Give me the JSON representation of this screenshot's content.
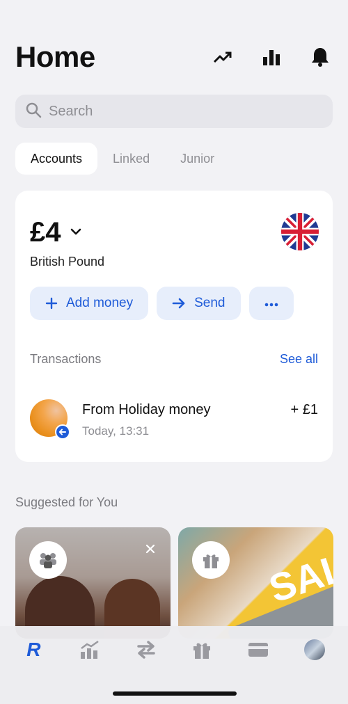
{
  "header": {
    "title": "Home",
    "icons": [
      "trending-icon",
      "bar-chart-icon",
      "bell-icon"
    ]
  },
  "search": {
    "placeholder": "Search",
    "value": ""
  },
  "tabs": [
    {
      "label": "Accounts",
      "active": true
    },
    {
      "label": "Linked",
      "active": false
    },
    {
      "label": "Junior",
      "active": false
    }
  ],
  "account": {
    "balance": "£4",
    "currency_name": "British Pound",
    "flag": "uk-flag-icon",
    "actions": {
      "add_money": "Add money",
      "send": "Send",
      "more": "more-icon"
    }
  },
  "transactions": {
    "title": "Transactions",
    "see_all": "See all",
    "items": [
      {
        "name": "From Holiday money",
        "time": "Today, 13:31",
        "amount": "+ £1"
      }
    ]
  },
  "suggested": {
    "title": "Suggested for You"
  },
  "sale_text": "SAL",
  "tabbar": {
    "items": [
      "home-icon",
      "invest-icon",
      "transfers-icon",
      "rewards-icon",
      "cards-icon",
      "profile-icon"
    ]
  },
  "colors": {
    "accent": "#1e5bd8",
    "background": "#f2f2f5",
    "button_bg": "#e7eefb"
  }
}
